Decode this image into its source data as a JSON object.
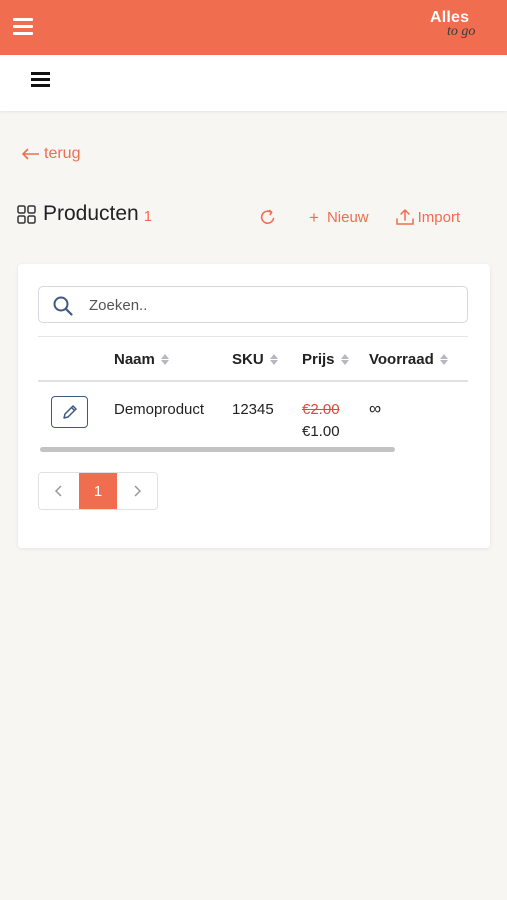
{
  "app": {
    "logo_line1": "Alles",
    "logo_line2": "to go",
    "brand_color": "#f06d4f"
  },
  "nav": {
    "back_label": "terug"
  },
  "page": {
    "title": "Producten",
    "count": "1"
  },
  "actions": {
    "new_label": "Nieuw",
    "import_label": "Import"
  },
  "search": {
    "placeholder": "Zoeken.."
  },
  "table": {
    "columns": [
      "Naam",
      "SKU",
      "Prijs",
      "Voorraad"
    ],
    "rows": [
      {
        "name": "Demoproduct",
        "sku": "12345",
        "price_old": "€2.00",
        "price": "€1.00",
        "stock": "∞"
      }
    ]
  },
  "pagination": {
    "prev": "‹",
    "current": "1",
    "next": "›"
  }
}
